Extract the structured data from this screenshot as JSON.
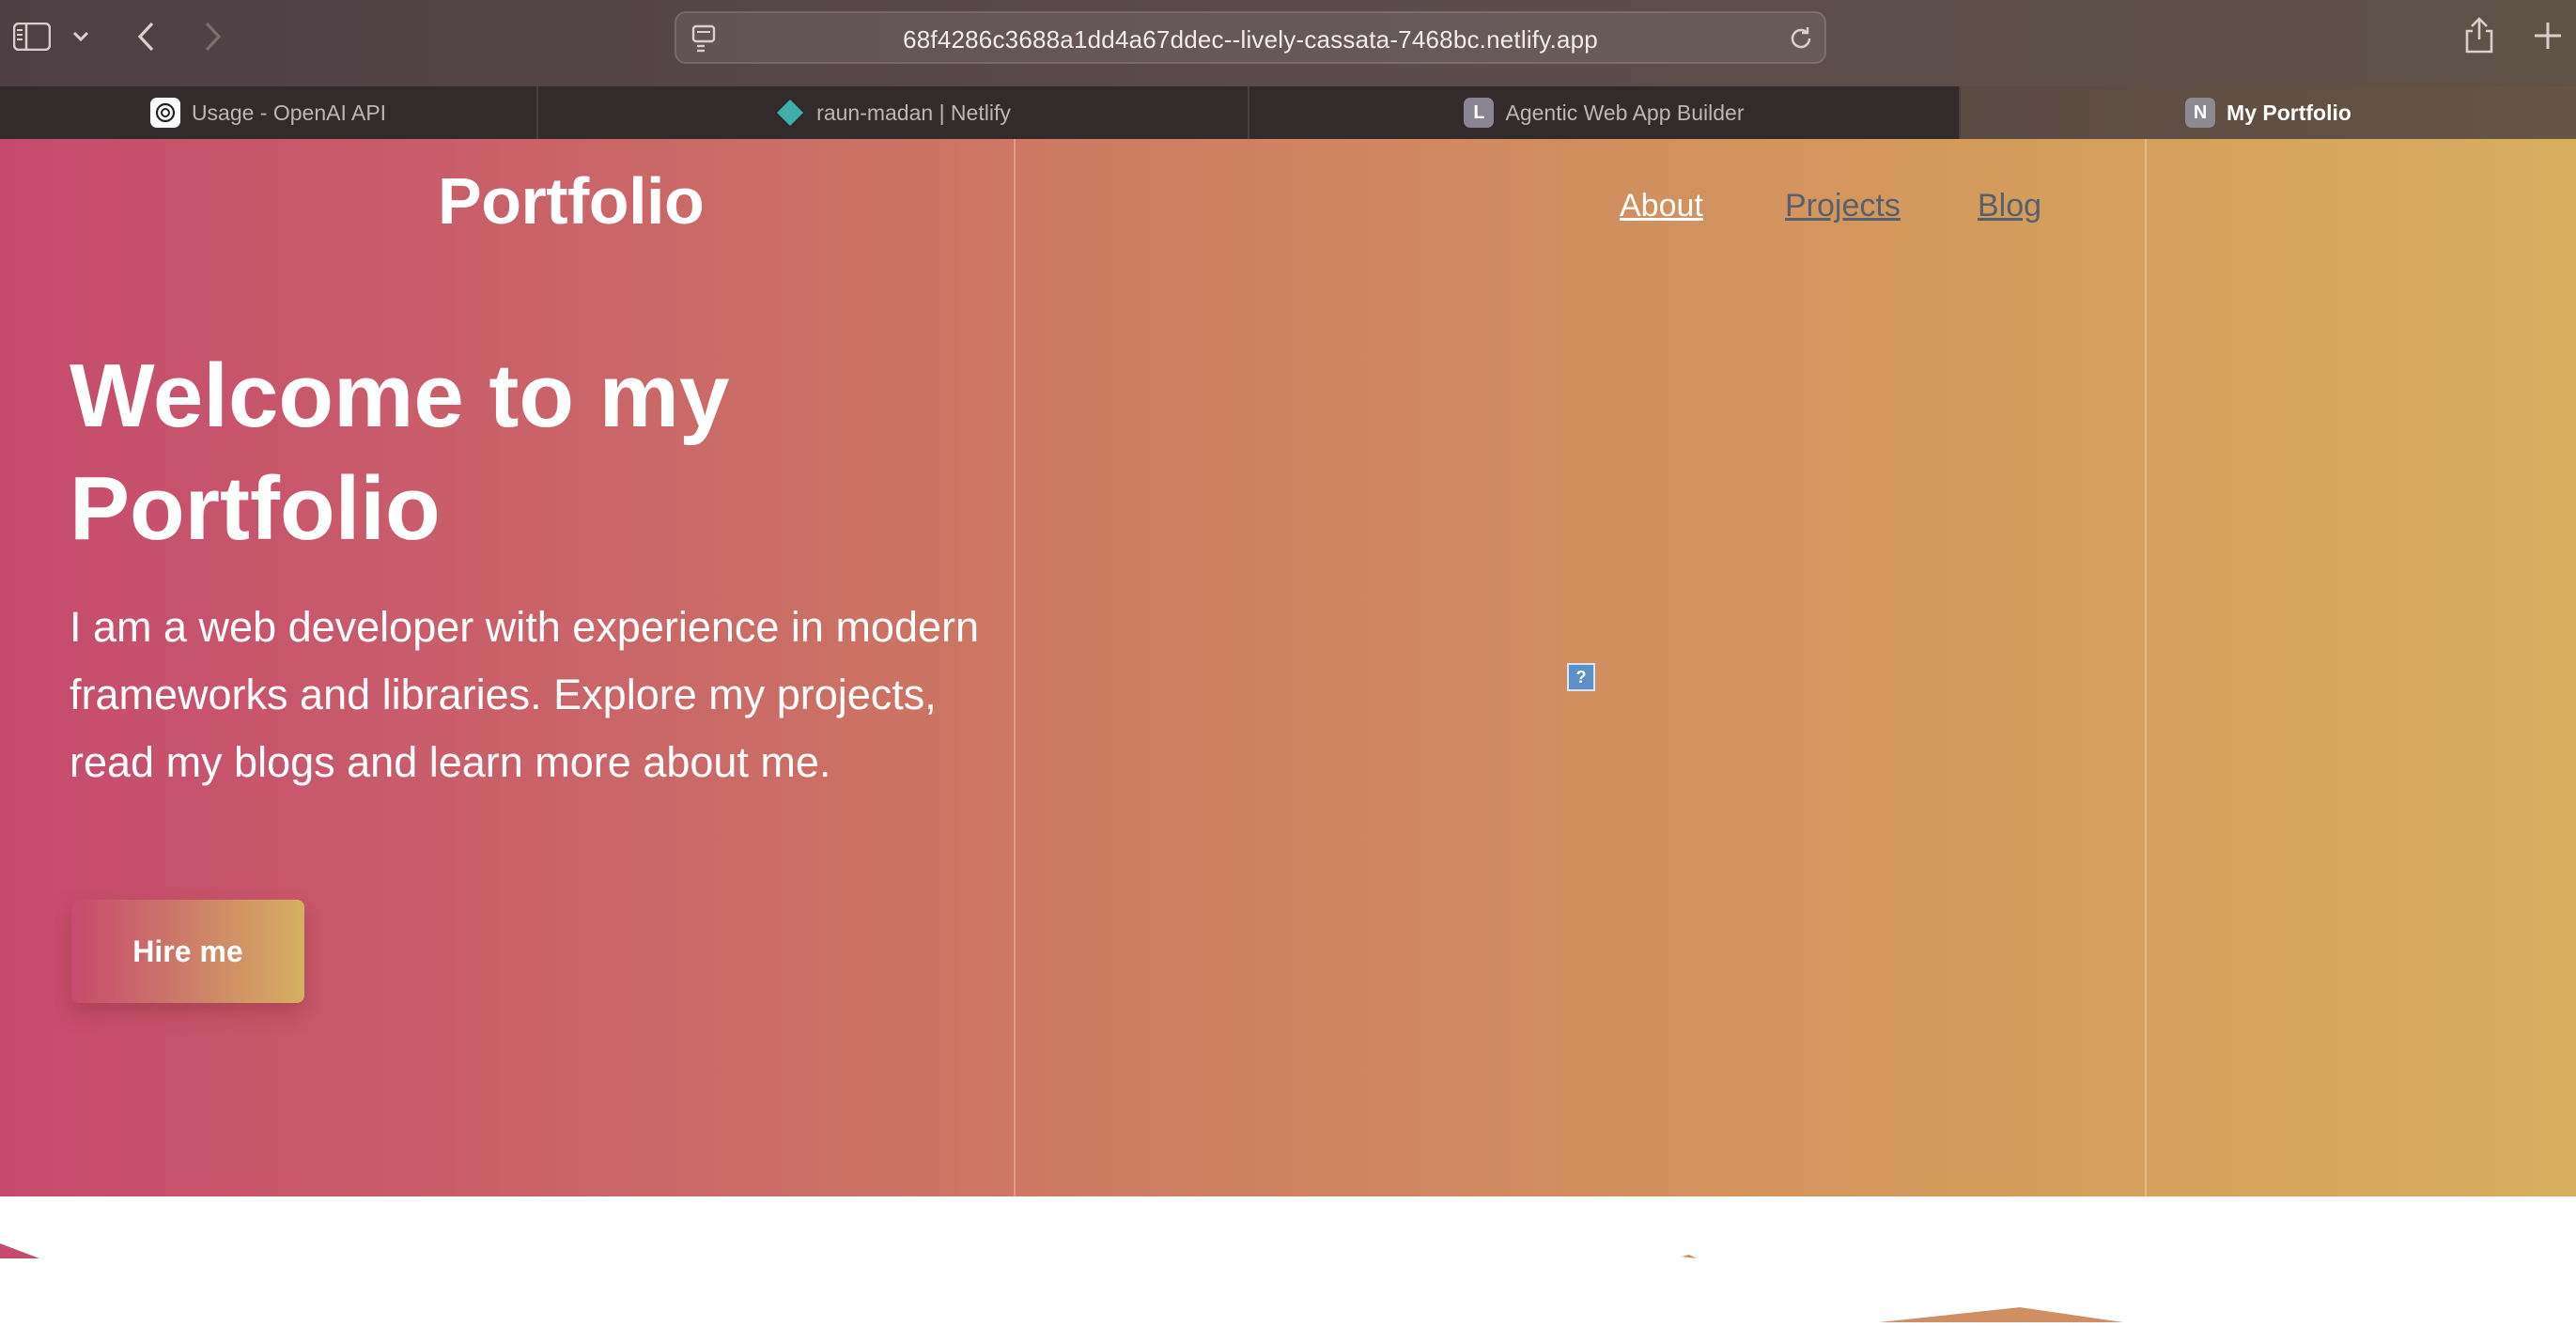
{
  "browser": {
    "url": "68f4286c3688a1dd4a67ddec--lively-cassata-7468bc.netlify.app",
    "icons": [
      "sidebar-icon",
      "chevron-down-icon",
      "back-icon",
      "forward-icon",
      "reader-icon",
      "reload-icon",
      "share-icon",
      "new-tab-icon"
    ],
    "tabs": [
      {
        "label": "Usage - OpenAI API",
        "favicon": "openai-icon",
        "active": false
      },
      {
        "label": "raun-madan | Netlify",
        "favicon": "netlify-icon",
        "active": false
      },
      {
        "label": "Agentic Web App Builder",
        "favicon": "L",
        "active": false
      },
      {
        "label": "My Portfolio",
        "favicon": "N",
        "active": true
      }
    ]
  },
  "page": {
    "brand": "Portfolio",
    "nav": [
      {
        "label": "About",
        "color": "#ffffff"
      },
      {
        "label": "Projects",
        "color": "#5a5f6e"
      },
      {
        "label": "Blog",
        "color": "#5a5f6e"
      }
    ],
    "headline": "Welcome to my Portfolio",
    "intro": "I am a web developer with experience in modern frameworks and libraries. Explore my projects, read my blogs and learn more about me.",
    "cta": "Hire me",
    "broken_image_glyph": "?"
  },
  "colors": {
    "gradient_start": "#c64a6e",
    "gradient_mid": "#cd7b62",
    "gradient_end": "#d7ae5e",
    "nav_inactive": "#5a5f6e"
  }
}
